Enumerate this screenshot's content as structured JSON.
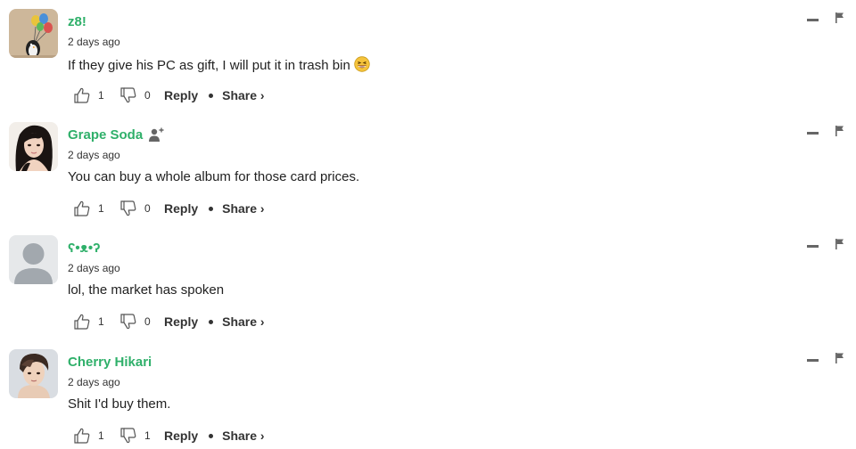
{
  "comments": [
    {
      "username": "z8!",
      "timestamp": "2 days ago",
      "text": "If they give his PC as gift, I will put it in trash bin",
      "emoji": "grinning-squinting-face",
      "likes": "1",
      "dislikes": "0",
      "avatar": "balloons-penguin-avatar",
      "follow_icon": false
    },
    {
      "username": "Grape Soda",
      "timestamp": "2 days ago",
      "text": "You can buy a whole album for those card prices.",
      "likes": "1",
      "dislikes": "0",
      "avatar": "woman-portrait-avatar",
      "follow_icon": true
    },
    {
      "username": "ʕ•ᴥ•ʔ",
      "timestamp": "2 days ago",
      "text": "lol, the market has spoken",
      "likes": "1",
      "dislikes": "0",
      "avatar": "default-person-avatar",
      "follow_icon": false
    },
    {
      "username": "Cherry Hikari",
      "timestamp": "2 days ago",
      "text": "Shit I'd buy them.",
      "likes": "1",
      "dislikes": "1",
      "avatar": "man-portrait-avatar",
      "follow_icon": false
    }
  ],
  "labels": {
    "reply": "Reply",
    "share": "Share ›"
  },
  "colors": {
    "username": "#2fb06a",
    "text": "#222222",
    "icon": "#666666"
  }
}
